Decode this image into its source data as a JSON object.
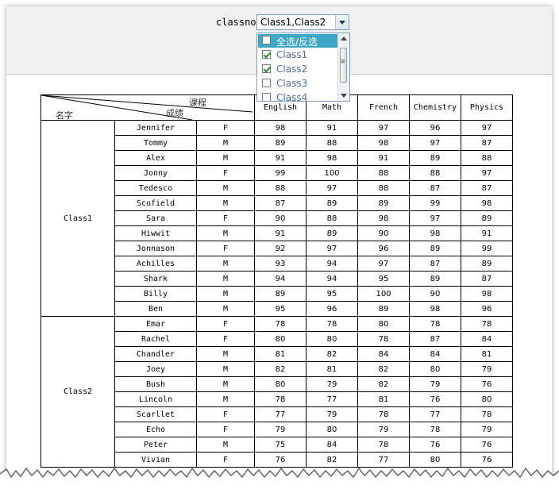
{
  "filter": {
    "label": "classno:",
    "selected": "Class1,Class2",
    "options": [
      {
        "label": "全选/反选",
        "checked": false
      },
      {
        "label": "Class1",
        "checked": true
      },
      {
        "label": "Class2",
        "checked": true
      },
      {
        "label": "Class3",
        "checked": false
      },
      {
        "label": "Class4",
        "checked": false
      }
    ]
  },
  "table": {
    "corner": {
      "course": "课程",
      "score": "成绩",
      "name": "名字"
    },
    "subjects": [
      "English",
      "Math",
      "French",
      "Chemistry",
      "Physics"
    ],
    "groups": [
      {
        "name": "Class1",
        "rows": [
          {
            "name": "Jennifer",
            "gender": "F",
            "scores": [
              "98",
              "91",
              "97",
              "96",
              "97"
            ]
          },
          {
            "name": "Tommy",
            "gender": "M",
            "scores": [
              "89",
              "88",
              "98",
              "97",
              "87"
            ]
          },
          {
            "name": "Alex",
            "gender": "M",
            "scores": [
              "91",
              "98",
              "91",
              "89",
              "88"
            ]
          },
          {
            "name": "Jonny",
            "gender": "F",
            "scores": [
              "99",
              "100",
              "88",
              "88",
              "97"
            ]
          },
          {
            "name": "Tedesco",
            "gender": "M",
            "scores": [
              "88",
              "97",
              "88",
              "87",
              "87"
            ]
          },
          {
            "name": "Scofield",
            "gender": "M",
            "scores": [
              "87",
              "89",
              "89",
              "99",
              "98"
            ]
          },
          {
            "name": "Sara",
            "gender": "F",
            "scores": [
              "90",
              "88",
              "98",
              "97",
              "89"
            ]
          },
          {
            "name": "Hiwwit",
            "gender": "M",
            "scores": [
              "91",
              "89",
              "90",
              "98",
              "91"
            ]
          },
          {
            "name": "Jonnason",
            "gender": "F",
            "scores": [
              "92",
              "97",
              "96",
              "89",
              "99"
            ]
          },
          {
            "name": "Achilles",
            "gender": "M",
            "scores": [
              "93",
              "94",
              "97",
              "87",
              "89"
            ]
          },
          {
            "name": "Shark",
            "gender": "M",
            "scores": [
              "94",
              "94",
              "95",
              "89",
              "87"
            ]
          },
          {
            "name": "Billy",
            "gender": "M",
            "scores": [
              "89",
              "95",
              "100",
              "90",
              "98"
            ]
          },
          {
            "name": "Ben",
            "gender": "M",
            "scores": [
              "95",
              "96",
              "89",
              "98",
              "96"
            ]
          }
        ]
      },
      {
        "name": "Class2",
        "rows": [
          {
            "name": "Emar",
            "gender": "F",
            "scores": [
              "78",
              "78",
              "80",
              "78",
              "78"
            ]
          },
          {
            "name": "Rachel",
            "gender": "F",
            "scores": [
              "80",
              "80",
              "78",
              "87",
              "84"
            ]
          },
          {
            "name": "Chandler",
            "gender": "M",
            "scores": [
              "81",
              "82",
              "84",
              "84",
              "81"
            ]
          },
          {
            "name": "Joey",
            "gender": "M",
            "scores": [
              "82",
              "81",
              "82",
              "80",
              "79"
            ]
          },
          {
            "name": "Bush",
            "gender": "M",
            "scores": [
              "80",
              "79",
              "82",
              "79",
              "76"
            ]
          },
          {
            "name": "Lincoln",
            "gender": "M",
            "scores": [
              "78",
              "77",
              "81",
              "76",
              "80"
            ]
          },
          {
            "name": "Scarllet",
            "gender": "F",
            "scores": [
              "77",
              "79",
              "78",
              "77",
              "78"
            ]
          },
          {
            "name": "Echo",
            "gender": "F",
            "scores": [
              "79",
              "80",
              "79",
              "78",
              "79"
            ]
          },
          {
            "name": "Peter",
            "gender": "M",
            "scores": [
              "75",
              "84",
              "78",
              "76",
              "76"
            ]
          },
          {
            "name": "Vivian",
            "gender": "F",
            "scores": [
              "76",
              "82",
              "77",
              "80",
              "76"
            ]
          }
        ]
      }
    ]
  }
}
